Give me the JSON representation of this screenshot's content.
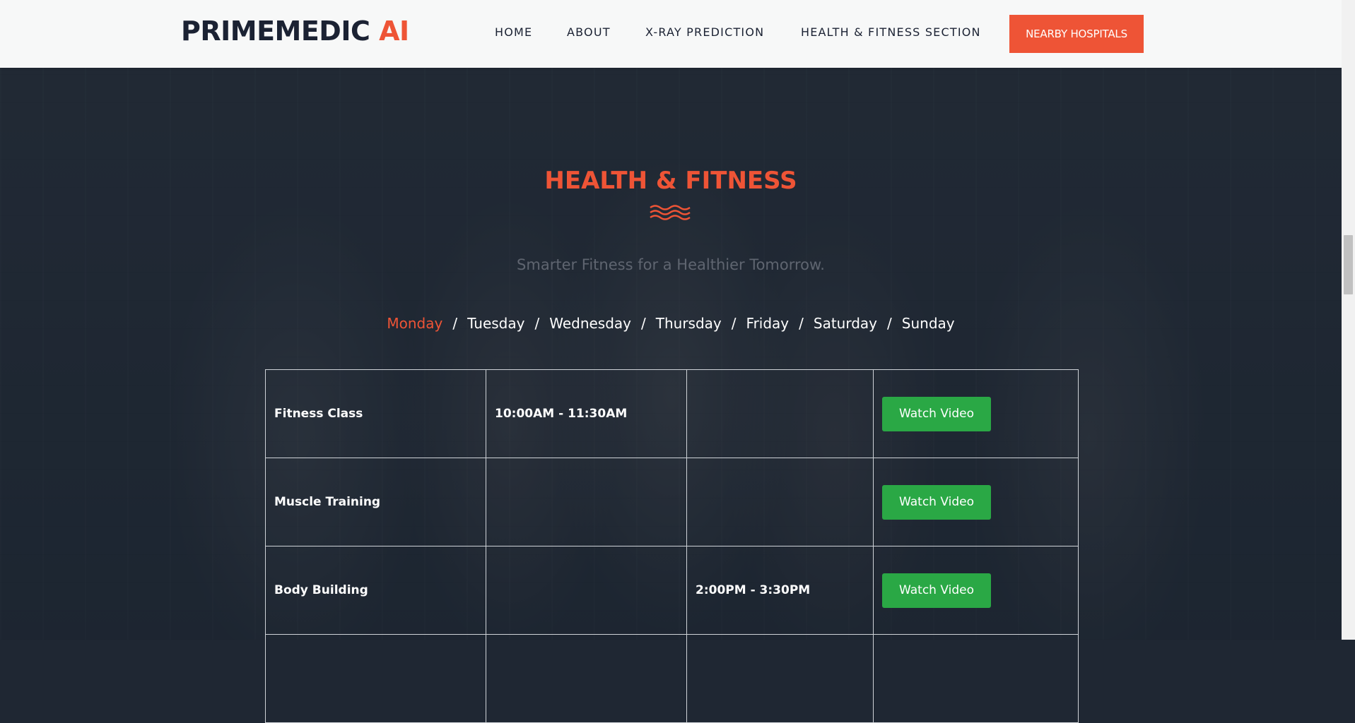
{
  "brand": {
    "name": "PRIMEMEDIC",
    "accent": "AI"
  },
  "nav": {
    "items": [
      "HOME",
      "ABOUT",
      "X-RAY PREDICTION",
      "HEALTH & FITNESS SECTION"
    ],
    "cta": "NEARBY HOSPITALS"
  },
  "section": {
    "title": "HEALTH & FITNESS",
    "subtitle": "Smarter Fitness for a Healthier Tomorrow."
  },
  "days": {
    "items": [
      "Monday",
      "Tuesday",
      "Wednesday",
      "Thursday",
      "Friday",
      "Saturday",
      "Sunday"
    ],
    "separator": "/",
    "active": "Monday"
  },
  "schedule": {
    "rows": [
      {
        "name": "Fitness Class",
        "time_a": "10:00AM - 11:30AM",
        "time_b": "",
        "action": "Watch Video"
      },
      {
        "name": "Muscle Training",
        "time_a": "",
        "time_b": "",
        "action": "Watch Video"
      },
      {
        "name": "Body Building",
        "time_a": "",
        "time_b": "2:00PM - 3:30PM",
        "action": "Watch Video"
      }
    ]
  },
  "colors": {
    "accent": "#ee5436",
    "button": "#2aa845",
    "header_bg": "#f7f8f8",
    "dark_text": "#1b2233"
  }
}
